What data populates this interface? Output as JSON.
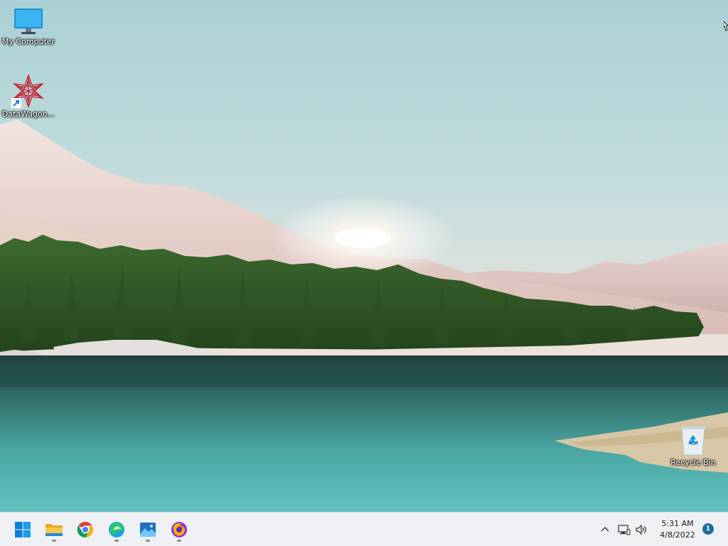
{
  "desktop": {
    "icons": [
      {
        "label": "My Computer",
        "icon": "monitor-icon"
      },
      {
        "label": "DataWagon...",
        "icon": "datawagon-shortcut-icon"
      },
      {
        "label": "Recycle Bin",
        "icon": "recycle-bin-icon"
      }
    ]
  },
  "taskbar": {
    "apps": [
      {
        "icon": "windows-start-icon",
        "running": false
      },
      {
        "icon": "file-explorer-icon",
        "running": true
      },
      {
        "icon": "chrome-icon",
        "running": false
      },
      {
        "icon": "edge-icon",
        "running": true
      },
      {
        "icon": "photos-icon",
        "running": true
      },
      {
        "icon": "firefox-icon",
        "running": true
      }
    ],
    "tray": {
      "icons": [
        "chevron-up-icon",
        "network-icon",
        "volume-icon"
      ],
      "time": "5:31 AM",
      "date": "4/8/2022",
      "notification_count": "1"
    }
  },
  "colors": {
    "taskbar_bg": "#eef0f3",
    "accent": "#0078d4",
    "badge": "#1f6f9e"
  }
}
